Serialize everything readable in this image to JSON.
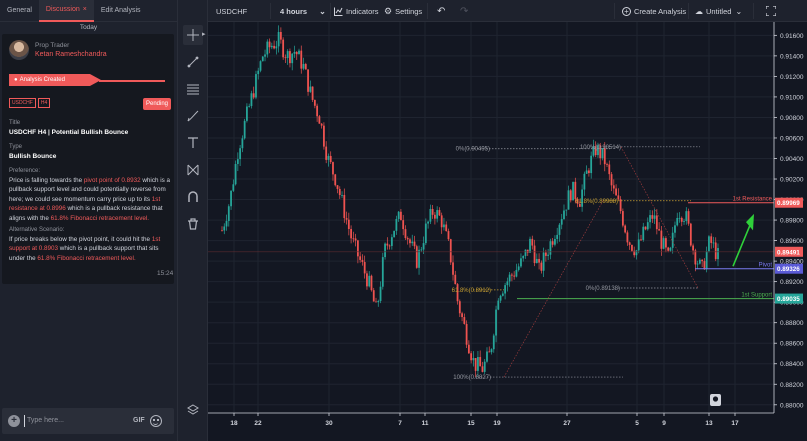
{
  "panel": {
    "tabs": [
      {
        "label": "General"
      },
      {
        "label": "Discussion"
      },
      {
        "label": "Edit Analysis"
      }
    ],
    "close_glyph": "×",
    "day_label": "Today",
    "message": {
      "role": "Prop Trader",
      "author": "Ketan Rameshchandra",
      "status_banner": "Analysis Created",
      "tags": [
        "USDCHF",
        "H4"
      ],
      "badge": "Pending",
      "title_label": "Title",
      "title_value": "USDCHF H4 | Potential Bullish Bounce",
      "type_label": "Type",
      "type_value": "Bullish Bounce",
      "pref_label": "Preference:",
      "pref_text": [
        {
          "t": "Price is falling towards the "
        },
        {
          "t": "pivot point of 0.8932",
          "h": true
        },
        {
          "t": " which is a pullback support level and could potentially reverse from here; we could see momentum carry price up to its "
        },
        {
          "t": "1st resistance at 0.8996",
          "h": true
        },
        {
          "t": " which is a pullback resistance that aligns with the "
        },
        {
          "t": "61.8% Fibonacci retracement level.",
          "h": true
        }
      ],
      "alt_label": "Alternative Scenario:",
      "alt_text": [
        {
          "t": "If price breaks below the pivot point, it could hit the "
        },
        {
          "t": "1st support at 0.8903",
          "h": true
        },
        {
          "t": " which is a pullback support that sits under the "
        },
        {
          "t": "61.8% Fibonacci retracement level.",
          "h": true
        }
      ],
      "time": "15:24"
    },
    "composer": {
      "placeholder": "Type here...",
      "gif_label": "GIF"
    }
  },
  "toolbar": {
    "symbol": "USDCHF",
    "interval": "4 hours",
    "indicators_label": "Indicators",
    "settings_label": "Settings",
    "create_label": "Create Analysis",
    "layout_name": "Untitled"
  },
  "tools": [
    "crosshair-icon",
    "trendline-icon",
    "fib-icon",
    "brush-icon",
    "text-icon",
    "pattern-icon",
    "magnet-icon",
    "trash-icon",
    "layers-icon"
  ],
  "chart_data": {
    "type": "candlestick",
    "symbol": "USDCHF",
    "x_ticks": [
      "18",
      "22",
      "30",
      "7",
      "11",
      "15",
      "19",
      "27",
      "5",
      "9",
      "13",
      "17"
    ],
    "y_ticks": [
      "0.91600",
      "0.91400",
      "0.91200",
      "0.91000",
      "0.90800",
      "0.90600",
      "0.90400",
      "0.90200",
      "0.90000",
      "0.89800",
      "0.89600",
      "0.89400",
      "0.89200",
      "0.89000",
      "0.88800",
      "0.88600",
      "0.88400",
      "0.88200",
      "0.88000"
    ],
    "ylim": [
      0.8792,
      0.9173
    ],
    "price_labels": [
      {
        "value": 0.89969,
        "text": "0.89969",
        "color": "#f05a5a"
      },
      {
        "value": 0.89491,
        "text": "0.89491",
        "color": "#f05a5a"
      },
      {
        "value": 0.89326,
        "text": "0.89326",
        "color": "#5b5bd6"
      },
      {
        "value": 0.89035,
        "text": "0.89035",
        "color": "#26a69a"
      }
    ],
    "levels": [
      {
        "name": "1st Resistance",
        "value": 0.89969,
        "color": "#f05a5a"
      },
      {
        "name": "Pivot",
        "value": 0.89326,
        "color": "#7b7bf0"
      },
      {
        "name": "1st Support",
        "value": 0.89035,
        "color": "#4caf50"
      }
    ],
    "fib_labels": [
      {
        "text": "0%(0.90495)",
        "value": 0.90495
      },
      {
        "text": "100%(0.90514)",
        "value": 0.90514
      },
      {
        "text": "61.8%(0.89988)",
        "value": 0.89988
      },
      {
        "text": "61.8%(0.8912)",
        "value": 0.8912
      },
      {
        "text": "0%(0.89138)",
        "value": 0.89138
      },
      {
        "text": "100%(0.8827)",
        "value": 0.8827
      }
    ],
    "candles_path": [
      0.897,
      0.9,
      0.905,
      0.908,
      0.911,
      0.914,
      0.915,
      0.9155,
      0.914,
      0.9145,
      0.913,
      0.91,
      0.908,
      0.904,
      0.902,
      0.899,
      0.896,
      0.894,
      0.892,
      0.889,
      0.895,
      0.897,
      0.8985,
      0.896,
      0.894,
      0.897,
      0.899,
      0.898,
      0.895,
      0.89,
      0.887,
      0.884,
      0.8835,
      0.885,
      0.891,
      0.892,
      0.893,
      0.894,
      0.896,
      0.893,
      0.895,
      0.897,
      0.899,
      0.901,
      0.9,
      0.903,
      0.905,
      0.904,
      0.901,
      0.899,
      0.896,
      0.895,
      0.897,
      0.8985,
      0.896,
      0.894,
      0.899,
      0.8985,
      0.895,
      0.893,
      0.896,
      0.8945
    ]
  }
}
